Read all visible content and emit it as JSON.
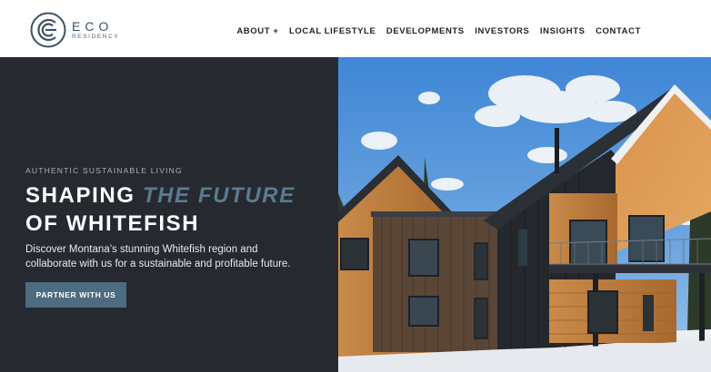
{
  "brand": {
    "name": "ECO",
    "tagline": "RESIDENCY",
    "color": "#3d5266"
  },
  "nav": {
    "items": [
      {
        "label": "ABOUT +"
      },
      {
        "label": "LOCAL LIFESTYLE"
      },
      {
        "label": "DEVELOPMENTS"
      },
      {
        "label": "INVESTORS"
      },
      {
        "label": "INSIGHTS"
      },
      {
        "label": "CONTACT"
      }
    ]
  },
  "hero": {
    "eyebrow": "AUTHENTIC SUSTAINABLE LIVING",
    "headline_part1": "SHAPING ",
    "headline_accent": "THE FUTURE",
    "headline_part2": "OF WHITEFISH",
    "subtext": "Discover Montana’s stunning Whitefish region and collaborate with us for a sustainable and profitable future.",
    "cta_label": "PARTNER WITH US",
    "panel_color": "#262a30",
    "accent_color": "#5b7a8f",
    "cta_color": "#4e6c80",
    "image": "modern-timber-home-photo"
  }
}
